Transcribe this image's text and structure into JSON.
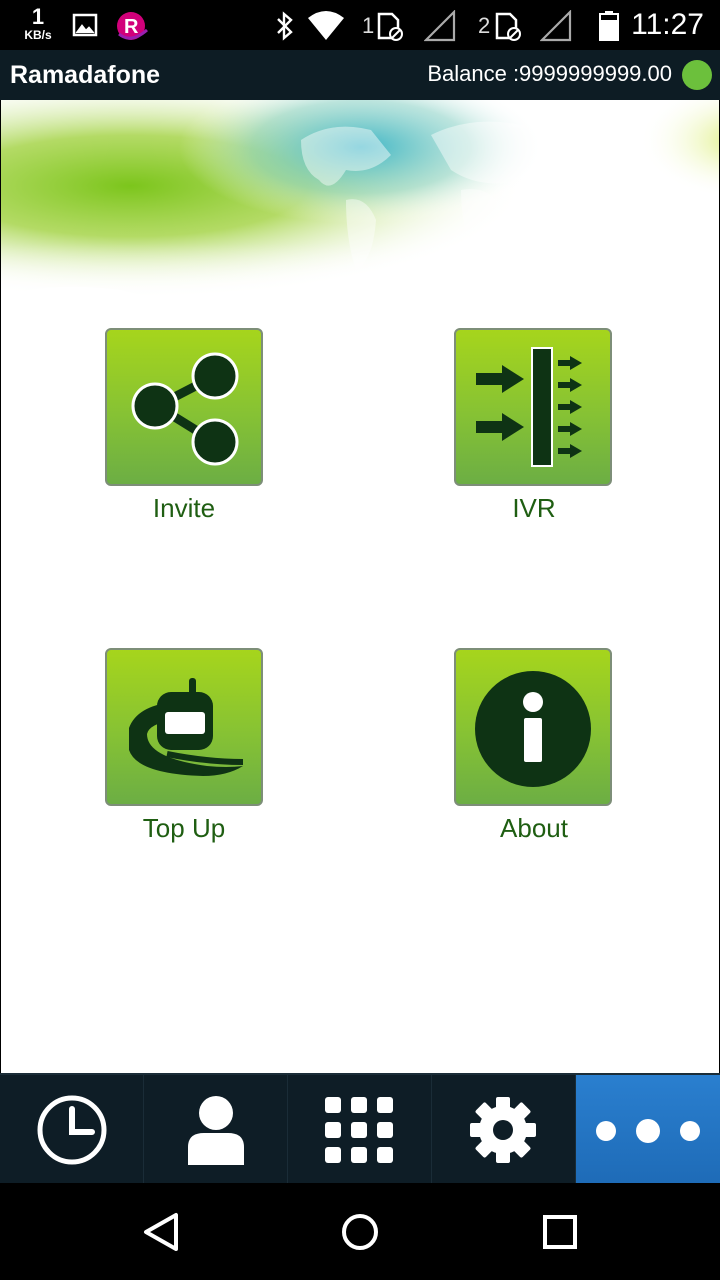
{
  "status_bar": {
    "net_speed_value": "1",
    "net_speed_unit": "KB/s",
    "sim1_label": "1",
    "sim2_label": "2",
    "time": "11:27",
    "icons": [
      "gallery-icon",
      "r-app-icon",
      "bluetooth-icon",
      "wifi-icon",
      "sim1-icon",
      "signal-icon",
      "sim2-icon",
      "signal-icon",
      "battery-icon"
    ]
  },
  "app_bar": {
    "title": "Ramadafone",
    "balance": "Balance :9999999999.00",
    "status_color": "#6cc03c"
  },
  "tiles": [
    {
      "label": "Invite",
      "icon": "share-icon"
    },
    {
      "label": "IVR",
      "icon": "ivr-icon"
    },
    {
      "label": "Top Up",
      "icon": "top-up-icon"
    },
    {
      "label": "About",
      "icon": "info-icon"
    }
  ],
  "bottom_nav": [
    {
      "name": "recent",
      "icon": "clock-icon",
      "active": false
    },
    {
      "name": "contacts",
      "icon": "person-icon",
      "active": false
    },
    {
      "name": "dialpad",
      "icon": "dialpad-icon",
      "active": false
    },
    {
      "name": "settings",
      "icon": "gear-icon",
      "active": false
    },
    {
      "name": "more",
      "icon": "more-icon",
      "active": true
    }
  ],
  "colors": {
    "accent": "#1e6bb7",
    "tile_green": "#86c234",
    "label_green": "#1f5e12",
    "nav_dark": "#0e1d26"
  }
}
